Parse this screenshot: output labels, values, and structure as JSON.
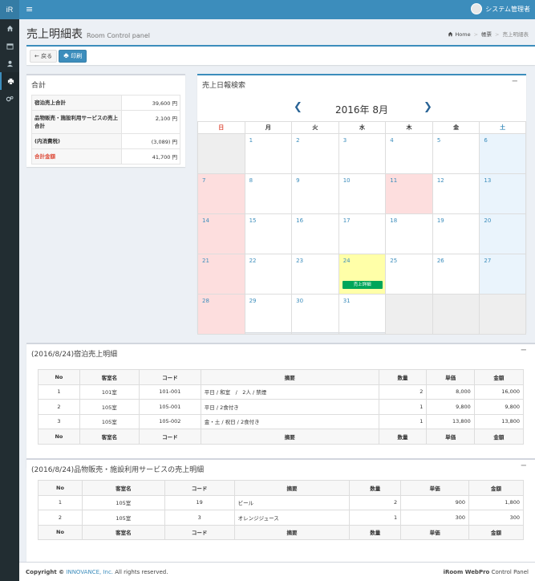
{
  "sidebar": {
    "logo": "iR",
    "icons": [
      "home-icon",
      "calendar-icon",
      "user-icon",
      "print-icon",
      "cogs-icon"
    ]
  },
  "topbar": {
    "menu_icon": "≡",
    "user_name": "システム管理者"
  },
  "header": {
    "title": "売上明細表",
    "subtitle": "Room Control panel"
  },
  "breadcrumb": {
    "home": "Home",
    "ledger": "帳票",
    "current": "売上明細表"
  },
  "toolbar": {
    "back_label": "戻る",
    "print_label": "印刷"
  },
  "summary": {
    "title": "合計",
    "rows": [
      {
        "label": "宿泊売上合計",
        "value": "39,600 円"
      },
      {
        "label": "品物販売・施設利用サービスの売上合計",
        "value": "2,100 円"
      },
      {
        "label": "(内消費税)",
        "value": "(3,089) 円"
      },
      {
        "label": "合計金額",
        "value": "41,700 円"
      }
    ]
  },
  "calendar": {
    "box_title": "売上日報検索",
    "month_title": "2016年 8月",
    "weekdays": [
      "日",
      "月",
      "火",
      "水",
      "木",
      "金",
      "土"
    ],
    "event_label": "売上詳細",
    "weeks": [
      [
        "",
        "1",
        "2",
        "3",
        "4",
        "5",
        "6"
      ],
      [
        "7",
        "8",
        "9",
        "10",
        "11",
        "12",
        "13"
      ],
      [
        "14",
        "15",
        "16",
        "17",
        "18",
        "19",
        "20"
      ],
      [
        "21",
        "22",
        "23",
        "24",
        "25",
        "26",
        "27"
      ],
      [
        "28",
        "29",
        "30",
        "31",
        "",
        "",
        ""
      ]
    ]
  },
  "lodging": {
    "title": "(2016/8/24)宿泊売上明細",
    "columns": [
      "No",
      "客室名",
      "コード",
      "摘要",
      "数量",
      "単価",
      "金額"
    ],
    "rows": [
      [
        "1",
        "101室",
        "101-001",
        "平日 / 和室　/　2人 / 禁煙",
        "2",
        "8,000",
        "16,000"
      ],
      [
        "2",
        "105室",
        "105-001",
        "平日 / 2食付き",
        "1",
        "9,800",
        "9,800"
      ],
      [
        "3",
        "105室",
        "105-002",
        "金・土 / 祝日 / 2食付き",
        "1",
        "13,800",
        "13,800"
      ]
    ]
  },
  "goods": {
    "title": "(2016/8/24)品物販売・施設利用サービスの売上明細",
    "columns": [
      "No",
      "客室名",
      "コード",
      "摘要",
      "数量",
      "単価",
      "金額"
    ],
    "rows": [
      [
        "1",
        "105室",
        "19",
        "ビール",
        "2",
        "900",
        "1,800"
      ],
      [
        "2",
        "105室",
        "3",
        "オレンジジュース",
        "1",
        "300",
        "300"
      ]
    ]
  },
  "footer": {
    "copyright_prefix": "Copyright ©",
    "company": "INNOVANCE, Inc.",
    "rights": "All rights reserved.",
    "product_bold": "iRoom WebPro",
    "product_rest": "Control Panel"
  },
  "colors": {
    "primary": "#3c8dbc",
    "sidebar": "#222d32",
    "success": "#00a65a",
    "danger": "#dd4b39"
  }
}
